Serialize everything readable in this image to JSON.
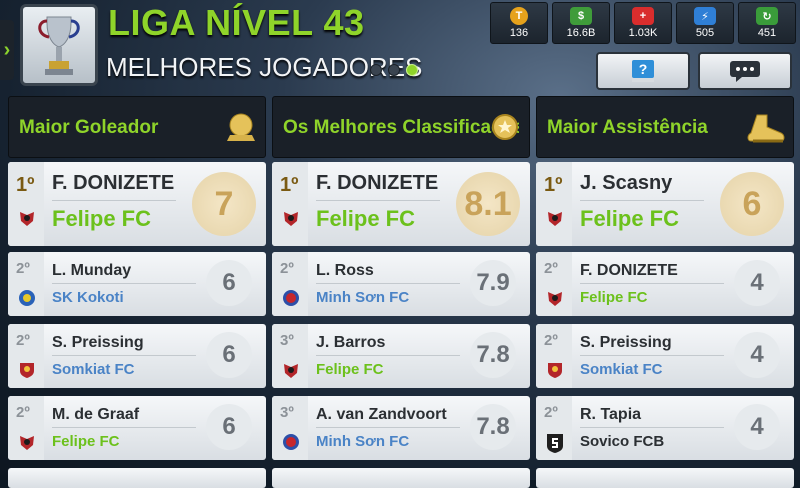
{
  "header": {
    "league_title": "LIGA NÍVEL 43",
    "subtitle": "MELHORES JOGADORES",
    "page_dots": 3,
    "active_dot": 2,
    "stats": [
      {
        "icon": "token-icon",
        "value": "136",
        "color": "#e6a21c"
      },
      {
        "icon": "cash-icon",
        "value": "16.6B",
        "color": "#3f9c3a"
      },
      {
        "icon": "medical-icon",
        "value": "1.03K",
        "color": "#d92d2d"
      },
      {
        "icon": "energy-icon",
        "value": "505",
        "color": "#2f7fd6"
      },
      {
        "icon": "training-icon",
        "value": "451",
        "color": "#3a9c3a"
      }
    ]
  },
  "columns": [
    {
      "title": "Maior Goleador",
      "icon": "golden-ball-icon",
      "rows": [
        {
          "rank": "1º",
          "name": "F. DONIZETE",
          "club": "Felipe FC",
          "club_style": "green",
          "value": "7"
        },
        {
          "rank": "2º",
          "name": "L. Munday",
          "club": "SK Kokoti",
          "club_style": "blue",
          "value": "6"
        },
        {
          "rank": "2º",
          "name": "S. Preissing",
          "club": "Somkiat FC",
          "club_style": "blue",
          "value": "6"
        },
        {
          "rank": "2º",
          "name": "M. de Graaf",
          "club": "Felipe FC",
          "club_style": "green",
          "value": "6"
        }
      ]
    },
    {
      "title": "Os Melhores Classificados",
      "icon": "rating-medal-icon",
      "rows": [
        {
          "rank": "1º",
          "name": "F. DONIZETE",
          "club": "Felipe FC",
          "club_style": "green",
          "value": "8.1"
        },
        {
          "rank": "2º",
          "name": "L. Ross",
          "club": "Minh Sơn FC",
          "club_style": "blue",
          "value": "7.9"
        },
        {
          "rank": "3º",
          "name": "J. Barros",
          "club": "Felipe FC",
          "club_style": "green",
          "value": "7.8"
        },
        {
          "rank": "3º",
          "name": "A. van Zandvoort",
          "club": "Minh Sơn FC",
          "club_style": "blue",
          "value": "7.8"
        }
      ]
    },
    {
      "title": "Maior Assistência",
      "icon": "golden-boot-icon",
      "rows": [
        {
          "rank": "1º",
          "name": "J. Scasny",
          "club": "Felipe FC",
          "club_style": "green",
          "value": "6"
        },
        {
          "rank": "2º",
          "name": "F. DONIZETE",
          "club": "Felipe FC",
          "club_style": "green",
          "value": "4"
        },
        {
          "rank": "2º",
          "name": "S. Preissing",
          "club": "Somkiat FC",
          "club_style": "blue",
          "value": "4"
        },
        {
          "rank": "2º",
          "name": "R. Tapia",
          "club": "Sovico FCB",
          "club_style": "dark",
          "value": "4"
        }
      ]
    }
  ]
}
